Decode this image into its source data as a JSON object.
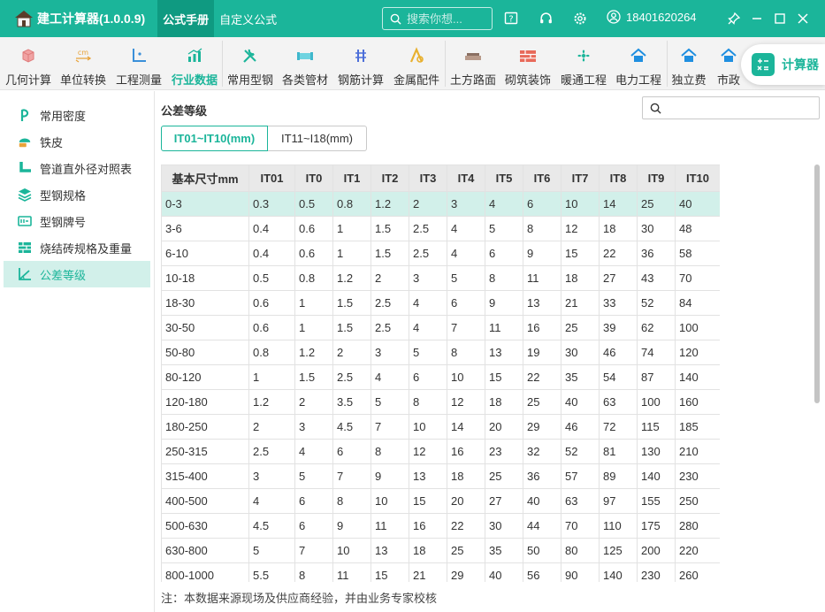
{
  "app": {
    "title": "建工计算器(1.0.0.9)"
  },
  "nav": {
    "tabs": [
      "公式手册",
      "自定义公式"
    ]
  },
  "search": {
    "placeholder": "搜索你想..."
  },
  "user": {
    "phone": "18401620264"
  },
  "toolbar": {
    "items": [
      "几何计算",
      "单位转换",
      "工程测量",
      "行业数据",
      "常用型钢",
      "各类管材",
      "钢筋计算",
      "金属配件",
      "土方路面",
      "砌筑装饰",
      "暖通工程",
      "电力工程",
      "独立费",
      "市政"
    ],
    "calc_label": "计算器"
  },
  "sidebar": {
    "items": [
      "常用密度",
      "铁皮",
      "管道直外径对照表",
      "型钢规格",
      "型钢牌号",
      "烧结砖规格及重量",
      "公差等级"
    ]
  },
  "main": {
    "title": "公差等级",
    "segments": [
      "IT01~IT10(mm)",
      "IT11~I18(mm)"
    ],
    "footnote": "注：本数据来源现场及供应商经验，并由业务专家校核"
  },
  "table": {
    "headers": [
      "基本尺寸mm",
      "IT01",
      "IT0",
      "IT1",
      "IT2",
      "IT3",
      "IT4",
      "IT5",
      "IT6",
      "IT7",
      "IT8",
      "IT9",
      "IT10"
    ],
    "rows": [
      [
        "0-3",
        "0.3",
        "0.5",
        "0.8",
        "1.2",
        "2",
        "3",
        "4",
        "6",
        "10",
        "14",
        "25",
        "40"
      ],
      [
        "3-6",
        "0.4",
        "0.6",
        "1",
        "1.5",
        "2.5",
        "4",
        "5",
        "8",
        "12",
        "18",
        "30",
        "48"
      ],
      [
        "6-10",
        "0.4",
        "0.6",
        "1",
        "1.5",
        "2.5",
        "4",
        "6",
        "9",
        "15",
        "22",
        "36",
        "58"
      ],
      [
        "10-18",
        "0.5",
        "0.8",
        "1.2",
        "2",
        "3",
        "5",
        "8",
        "11",
        "18",
        "27",
        "43",
        "70"
      ],
      [
        "18-30",
        "0.6",
        "1",
        "1.5",
        "2.5",
        "4",
        "6",
        "9",
        "13",
        "21",
        "33",
        "52",
        "84"
      ],
      [
        "30-50",
        "0.6",
        "1",
        "1.5",
        "2.5",
        "4",
        "7",
        "11",
        "16",
        "25",
        "39",
        "62",
        "100"
      ],
      [
        "50-80",
        "0.8",
        "1.2",
        "2",
        "3",
        "5",
        "8",
        "13",
        "19",
        "30",
        "46",
        "74",
        "120"
      ],
      [
        "80-120",
        "1",
        "1.5",
        "2.5",
        "4",
        "6",
        "10",
        "15",
        "22",
        "35",
        "54",
        "87",
        "140"
      ],
      [
        "120-180",
        "1.2",
        "2",
        "3.5",
        "5",
        "8",
        "12",
        "18",
        "25",
        "40",
        "63",
        "100",
        "160"
      ],
      [
        "180-250",
        "2",
        "3",
        "4.5",
        "7",
        "10",
        "14",
        "20",
        "29",
        "46",
        "72",
        "115",
        "185"
      ],
      [
        "250-315",
        "2.5",
        "4",
        "6",
        "8",
        "12",
        "16",
        "23",
        "32",
        "52",
        "81",
        "130",
        "210"
      ],
      [
        "315-400",
        "3",
        "5",
        "7",
        "9",
        "13",
        "18",
        "25",
        "36",
        "57",
        "89",
        "140",
        "230"
      ],
      [
        "400-500",
        "4",
        "6",
        "8",
        "10",
        "15",
        "20",
        "27",
        "40",
        "63",
        "97",
        "155",
        "250"
      ],
      [
        "500-630",
        "4.5",
        "6",
        "9",
        "11",
        "16",
        "22",
        "30",
        "44",
        "70",
        "110",
        "175",
        "280"
      ],
      [
        "630-800",
        "5",
        "7",
        "10",
        "13",
        "18",
        "25",
        "35",
        "50",
        "80",
        "125",
        "200",
        "220"
      ],
      [
        "800-1000",
        "5.5",
        "8",
        "11",
        "15",
        "21",
        "29",
        "40",
        "56",
        "90",
        "140",
        "230",
        "260"
      ]
    ]
  },
  "colors": {
    "accent": "#1bb59a",
    "accent_dark": "#0f9a81",
    "highlight": "#d2f0ea"
  }
}
